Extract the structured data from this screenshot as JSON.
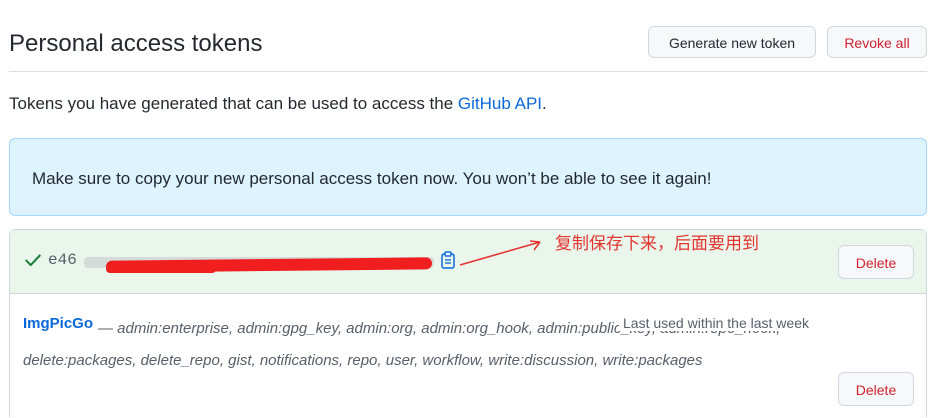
{
  "header": {
    "title": "Personal access tokens",
    "generate_label": "Generate new token",
    "revoke_label": "Revoke all"
  },
  "description": {
    "text": "Tokens you have generated that can be used to access the ",
    "link": "GitHub API",
    "suffix": "."
  },
  "flash": {
    "message": "Make sure to copy your new personal access token now. You won’t be able to see it again!"
  },
  "new_token": {
    "value_prefix": "e46",
    "delete_label": "Delete",
    "annotation": "复制保存下来，后面要用到"
  },
  "token_list": [
    {
      "name": "ImgPicGo",
      "separator": "—",
      "scopes": "admin:enterprise, admin:gpg_key, admin:org, admin:org_hook, admin:public_key, admin:repo_hook, delete:packages, delete_repo, gist, notifications, repo, user, workflow, write:discussion, write:packages",
      "last_used": "Last used within the last week",
      "delete_label": "Delete"
    }
  ],
  "colors": {
    "link": "#0969da",
    "danger": "#cf222e",
    "flash_bg": "#ddf4ff",
    "success_bg": "#eaf6ec",
    "annotation": "#e3342f"
  },
  "icons": {
    "check": "check-icon",
    "copy": "clipboard-icon"
  }
}
